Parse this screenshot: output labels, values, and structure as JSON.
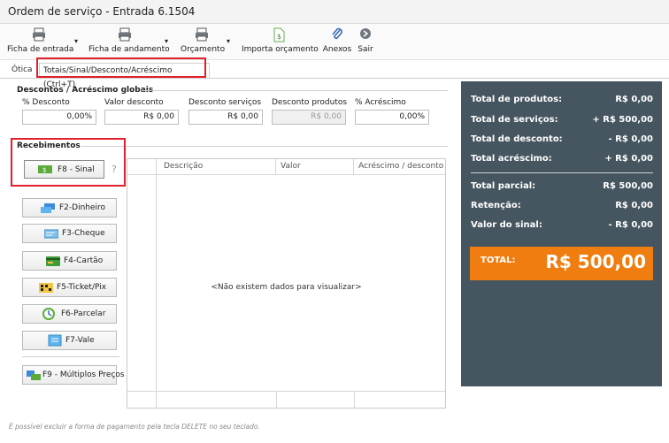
{
  "window": {
    "title": "Ordem de serviço - Entrada  6.1504"
  },
  "toolbar": {
    "items": [
      {
        "label": "Ficha de entrada"
      },
      {
        "label": "Ficha de andamento"
      },
      {
        "label": "Orçamento"
      },
      {
        "label": "Importa orçamento"
      },
      {
        "label": "Anexos"
      },
      {
        "label": "Sair"
      }
    ]
  },
  "tabs": [
    {
      "label": "Ótica"
    },
    {
      "label": "Totais/Sinal/Desconto/Acréscimo (Ctrl+T)"
    }
  ],
  "descontos": {
    "title": "Descontos / Acréscimo globais",
    "fields": [
      {
        "label": "% Desconto",
        "value": "0,00%"
      },
      {
        "label": "Valor desconto",
        "value": "R$ 0,00"
      },
      {
        "label": "Desconto serviços",
        "value": "R$ 0,00"
      },
      {
        "label": "Desconto produtos",
        "value": "R$ 0,00"
      },
      {
        "label": "% Acréscimo",
        "value": "0,00%"
      }
    ]
  },
  "recebimentos": {
    "title": "Recebimentos",
    "sinal_button": "F8 - Sinal",
    "help": "?",
    "buttons": [
      {
        "label": "F2-Dinheiro"
      },
      {
        "label": "F3-Cheque"
      },
      {
        "label": "F4-Cartão"
      },
      {
        "label": "F5-Ticket/Pix"
      },
      {
        "label": "F6-Parcelar"
      },
      {
        "label": "F7-Vale"
      }
    ],
    "multi_button": "F9 - Múltiplos Preços"
  },
  "grid": {
    "columns": [
      "Descrição",
      "Valor",
      "Acréscimo / desconto"
    ],
    "empty_text": "<Não existem dados para visualizar>"
  },
  "totals": {
    "rows": [
      {
        "label": "Total de produtos:",
        "value": "R$ 0,00"
      },
      {
        "label": "Total de serviços:",
        "value": "+ R$ 500,00"
      },
      {
        "label": "Total de desconto:",
        "value": "- R$ 0,00"
      },
      {
        "label": "Total acréscimo:",
        "value": "+ R$ 0,00"
      },
      {
        "label": "Total parcial:",
        "value": "R$ 500,00"
      },
      {
        "label": "Retenção:",
        "value": "R$ 0,00"
      },
      {
        "label": "Valor do sinal:",
        "value": "- R$ 0,00"
      }
    ],
    "total_label": "TOTAL:",
    "total_value": "R$ 500,00"
  },
  "footer": {
    "hint": "É possível excluir a forma de pagamento pela tecla DELETE no seu teclado."
  },
  "colors": {
    "panel": "#465660",
    "total": "#f07d10",
    "highlight": "#e0212a"
  }
}
